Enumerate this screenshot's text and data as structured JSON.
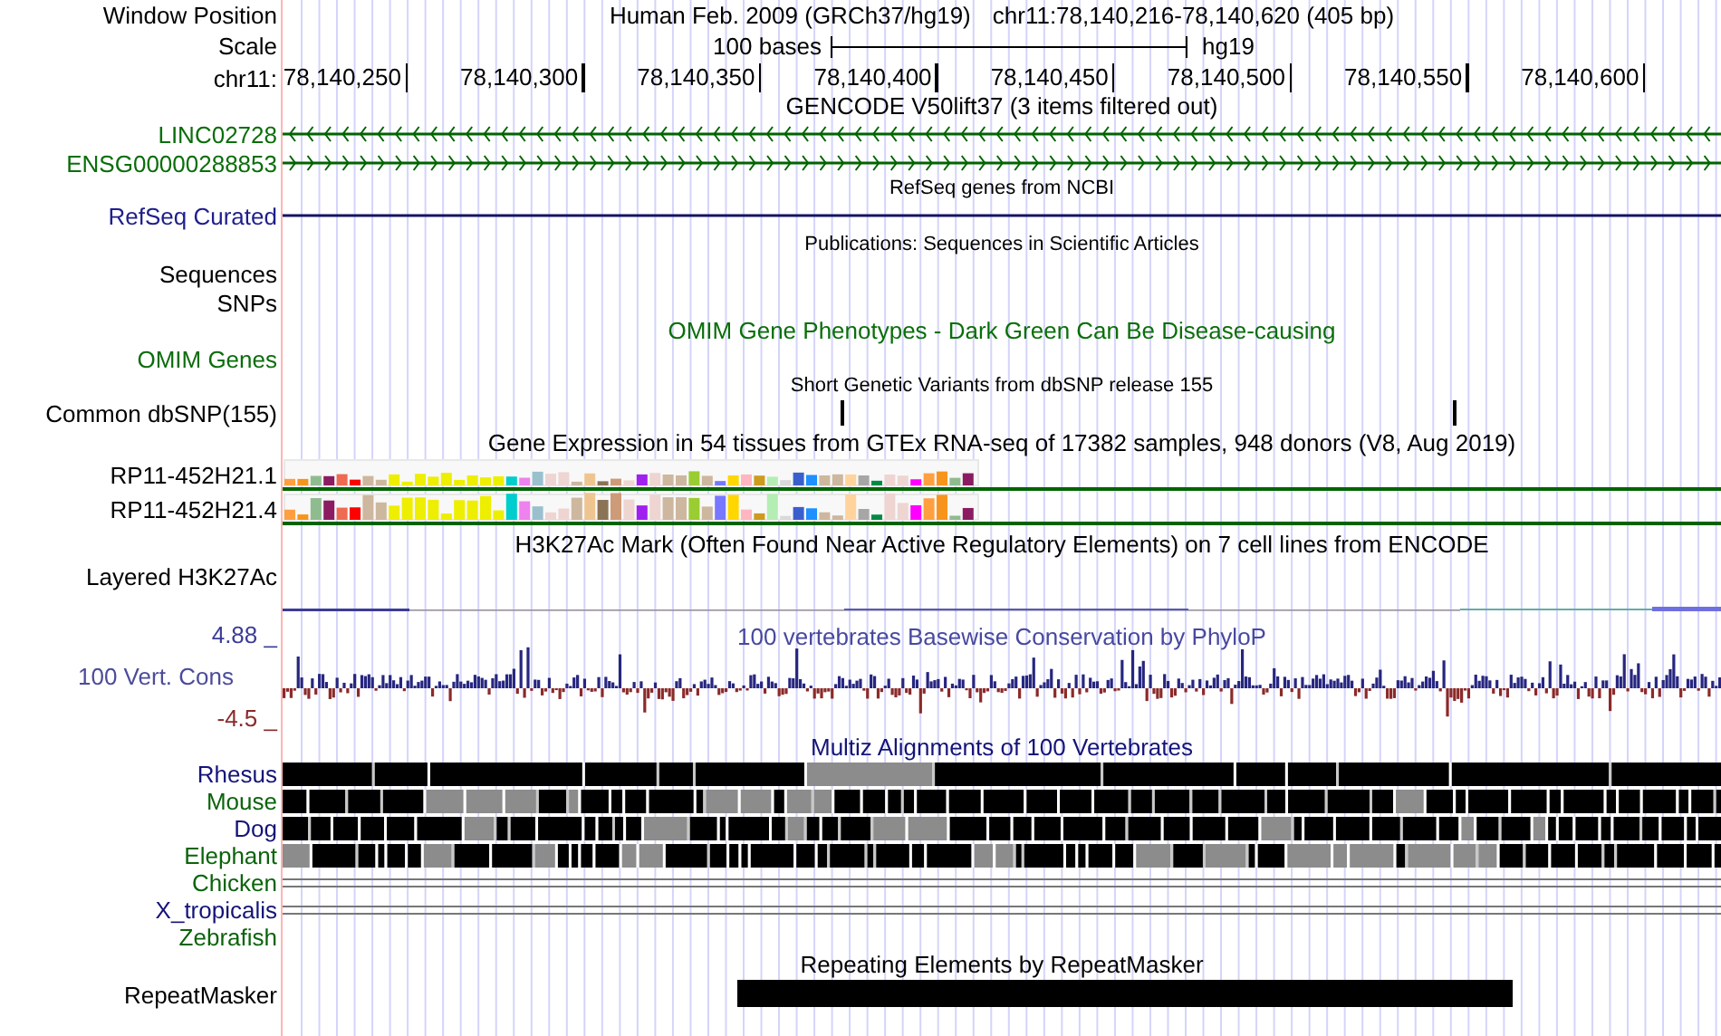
{
  "header": {
    "labels": [
      "Window Position",
      "Scale",
      "chr11:"
    ],
    "assembly_title": "Human Feb. 2009 (GRCh37/hg19)",
    "position": "chr11:78,140,216-78,140,620 (405 bp)",
    "scale_label": "100 bases",
    "scale_assembly": "hg19",
    "ruler_ticks": [
      "78,140,250",
      "78,140,300",
      "78,140,350",
      "78,140,400",
      "78,140,450",
      "78,140,500",
      "78,140,550",
      "78,140,600"
    ]
  },
  "tracks": [
    {
      "kind": "gencode",
      "title": "GENCODE V50lift37 (3 items filtered out)",
      "items": [
        {
          "label": "LINC02728",
          "reverse_strand": true
        },
        {
          "label": "ENSG00000288853",
          "reverse_strand": false
        }
      ]
    },
    {
      "kind": "refseq",
      "title": "RefSeq genes from NCBI",
      "label": "RefSeq Curated"
    },
    {
      "kind": "publications",
      "title": "Publications: Sequences in Scientific Articles",
      "labels": [
        "Sequences",
        "SNPs"
      ]
    },
    {
      "kind": "omim",
      "title": "OMIM Gene Phenotypes - Dark Green Can Be Disease-causing",
      "label": "OMIM Genes"
    },
    {
      "kind": "dbsnp",
      "title": "Short Genetic Variants from dbSNP release 155",
      "label": "Common dbSNP(155)"
    },
    {
      "kind": "gtex",
      "title": "Gene Expression in 54 tissues from GTEx RNA-seq of 17382 samples, 948 donors (V8, Aug 2019)",
      "rows": [
        {
          "label": "RP11-452H21.1"
        },
        {
          "label": "RP11-452H21.4"
        }
      ]
    },
    {
      "kind": "h3k27ac",
      "title": "H3K27Ac Mark (Often Found Near Active Regulatory Elements) on 7 cell lines from ENCODE",
      "label": "Layered H3K27Ac"
    },
    {
      "kind": "phylop",
      "title": "100 vertebrates Basewise Conservation by PhyloP",
      "label": "100 Vert. Cons",
      "max_label": "4.88 _",
      "min_label": "-4.5 _"
    },
    {
      "kind": "multiz",
      "title": "Multiz Alignments of 100 Vertebrates",
      "species": [
        {
          "label": "Rhesus",
          "kind": "blocks",
          "color": "#141478"
        },
        {
          "label": "Mouse",
          "kind": "blocks",
          "color": "#0a640a"
        },
        {
          "label": "Dog",
          "kind": "blocks",
          "color": "#141478"
        },
        {
          "label": "Elephant",
          "kind": "blocks",
          "color": "#0a640a"
        },
        {
          "label": "Chicken",
          "kind": "gap",
          "color": "#0a640a"
        },
        {
          "label": "X_tropicalis",
          "kind": "gap",
          "color": "#141478"
        },
        {
          "label": "Zebrafish",
          "kind": "blank",
          "color": "#0a640a"
        }
      ]
    },
    {
      "kind": "repeatmasker",
      "title": "Repeating Elements by RepeatMasker",
      "label": "RepeatMasker"
    }
  ]
}
